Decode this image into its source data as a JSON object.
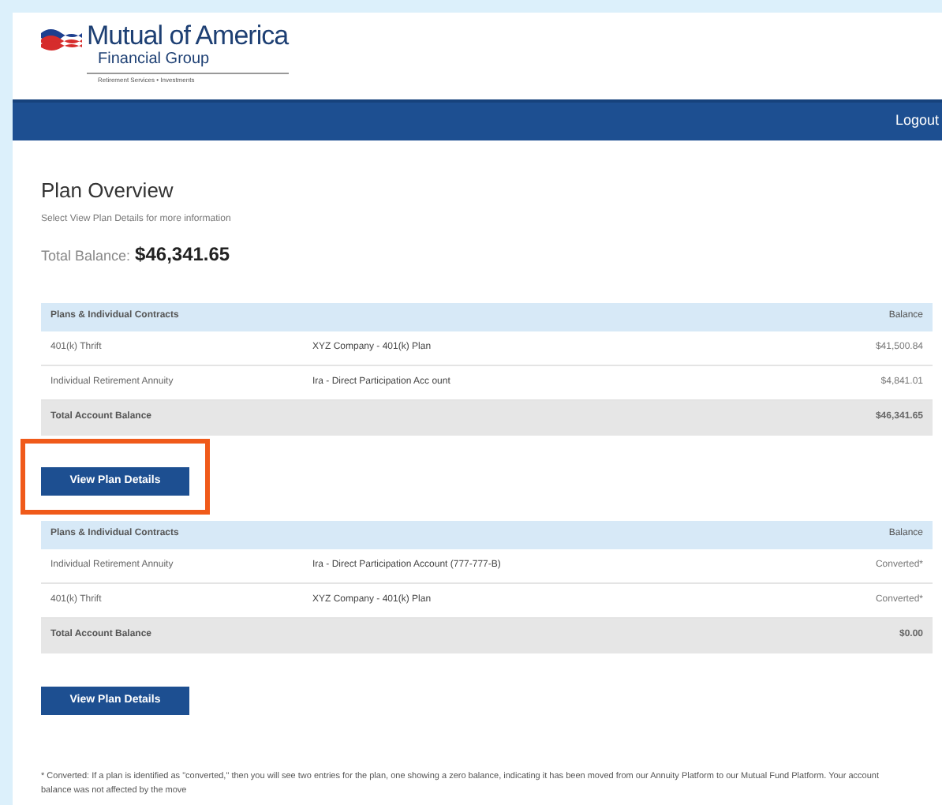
{
  "logo": {
    "name": "Mutual of America",
    "subname": "Financial Group",
    "tagline": "Retirement Services • Investments"
  },
  "nav": {
    "logout": "Logout"
  },
  "overview": {
    "title": "Plan Overview",
    "subtitle": "Select View Plan Details for more information",
    "total_label": "Total Balance:",
    "total_value": "$46,341.65"
  },
  "sections": [
    {
      "columns": [
        "Plans & Individual Contracts",
        "Balance"
      ],
      "rows": [
        {
          "type": "401(k) Thrift",
          "plan": "XYZ Company - 401(k) Plan",
          "balance": "$41,500.84"
        },
        {
          "type": "Individual Retirement Annuity",
          "plan": "Ira - Direct Participation Acc ount",
          "balance": "$4,841.01"
        }
      ],
      "total_label": "Total Account Balance",
      "total_value": "$46,341.65",
      "button": "View Plan Details",
      "highlighted": true
    },
    {
      "columns": [
        "Plans & Individual Contracts",
        "Balance"
      ],
      "rows": [
        {
          "type": "Individual Retirement Annuity",
          "plan": "Ira - Direct Participation Account (777-777-B)",
          "balance": "Converted*"
        },
        {
          "type": "401(k) Thrift",
          "plan": "XYZ Company - 401(k) Plan",
          "balance": "Converted*"
        }
      ],
      "total_label": "Total Account Balance",
      "total_value": "$0.00",
      "button": "View Plan Details",
      "highlighted": false
    }
  ],
  "footnote": "* Converted: If a plan is identified as \"converted,\" then you will see two entries for the plan, one showing a zero balance, indicating it has been moved from our Annuity Platform to our Mutual Fund Platform. Your account balance was not affected by the move"
}
